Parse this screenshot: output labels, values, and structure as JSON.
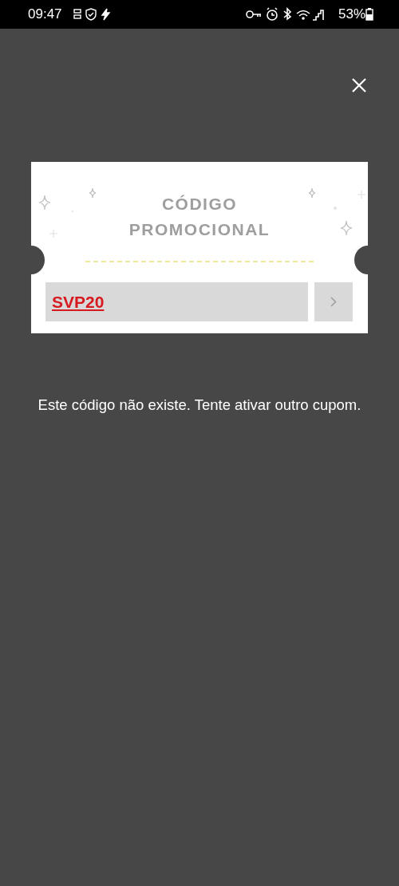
{
  "status_bar": {
    "time": "09:47",
    "battery": "53%"
  },
  "coupon": {
    "title_lines": [
      "CÓDIGO",
      "PROMOCIONAL"
    ],
    "code": {
      "value": "SVP20",
      "error": true
    }
  },
  "message": "Este código não existe. Tente ativar outro cupom."
}
